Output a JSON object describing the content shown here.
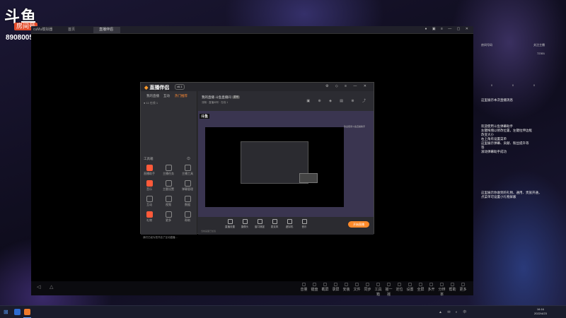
{
  "watermark": {
    "logo": "斗鱼",
    "room_label": "房间号",
    "room_number": "8908005"
  },
  "emulator": {
    "home_tab": "首页",
    "active_tab": "直播伴侣",
    "title_fragment": "cuMu模拟器"
  },
  "emulator_nav": {
    "back": "◁",
    "home": "△"
  },
  "emulator_tools": [
    {
      "label": "音量",
      "icon": "speaker-icon"
    },
    {
      "label": "键盘",
      "icon": "keyboard-icon"
    },
    {
      "label": "截屏",
      "icon": "screenshot-icon"
    },
    {
      "label": "录屏",
      "icon": "record-icon"
    },
    {
      "label": "安装",
      "icon": "install-icon"
    },
    {
      "label": "文件",
      "icon": "folder-icon"
    },
    {
      "label": "同步",
      "icon": "sync-icon"
    },
    {
      "label": "工具箱",
      "icon": "toolbox-icon"
    },
    {
      "label": "摇一摇",
      "icon": "shake-icon"
    },
    {
      "label": "定位",
      "icon": "location-icon"
    },
    {
      "label": "设置",
      "icon": "settings-icon"
    },
    {
      "label": "全屏",
      "icon": "fullscreen-icon"
    },
    {
      "label": "多开",
      "icon": "multi-icon"
    },
    {
      "label": "分辨率",
      "icon": "resolution-icon"
    },
    {
      "label": "帮助",
      "icon": "help-icon"
    },
    {
      "label": "更多",
      "icon": "more-icon"
    }
  ],
  "app": {
    "logo_main": "直播伴侣",
    "version": "v6.1",
    "left_tabs": [
      "我的直播",
      "互动",
      "热门推荐"
    ],
    "left_sub": "● 11 在线 1",
    "section_title": "工具箱",
    "features": [
      {
        "label": "直播助手",
        "hot": true
      },
      {
        "label": "主播任务",
        "hot": false
      },
      {
        "label": "主播工具",
        "hot": false
      },
      {
        "label": "音乐",
        "hot": true
      },
      {
        "label": "主题设置",
        "hot": false
      },
      {
        "label": "弹幕管理",
        "hot": false
      },
      {
        "label": "互动",
        "hot": false
      },
      {
        "label": "视频",
        "hot": false
      },
      {
        "label": "数据",
        "hot": false
      },
      {
        "label": "礼物",
        "hot": true
      },
      {
        "label": "更多",
        "hot": false
      },
      {
        "label": "帮助",
        "hot": false
      }
    ],
    "left_footer": "我们已经为您开启了互动直播…",
    "stream": {
      "name": "我的直播 斗鱼直播间",
      "tag": "游戏",
      "meta": "流畅 · 直播间号 · 在线 1"
    },
    "preview_brand": "斗鱼",
    "preview_side": "欢迎使用斗鱼直播助手",
    "tools": [
      "直播设置",
      "摄像头",
      "窗口捕捉",
      "麦克风",
      "虚拟机",
      "音乐"
    ],
    "start_button": "开始直播",
    "stream_footer": "当前画面已加载"
  },
  "chat": {
    "room_left": "房间号码",
    "room_right": "关注主播",
    "stat_follow": "72301",
    "stats": [
      "0",
      "0",
      "0"
    ],
    "system_msg": "这里展示本次直播消息",
    "messages": [
      "欢迎使用斗鱼弹幕助手",
      "左键拖拽以修改位置，左键拉伸边框",
      "改变大小",
      "右上角有设置菜单",
      "这里展示弹幕、贡献、粉丝提升等",
      "等",
      "滚动弹幕助手成功"
    ],
    "messages2": [
      "这里展示你收到的礼物、通用、贵族开通，",
      "点菜单可设置小礼物屏蔽"
    ]
  },
  "taskbar": {
    "start_icon": "⊞",
    "tray": "▲ ✉ ◐ 中",
    "time": "16:16",
    "date": "2022/4/23"
  }
}
